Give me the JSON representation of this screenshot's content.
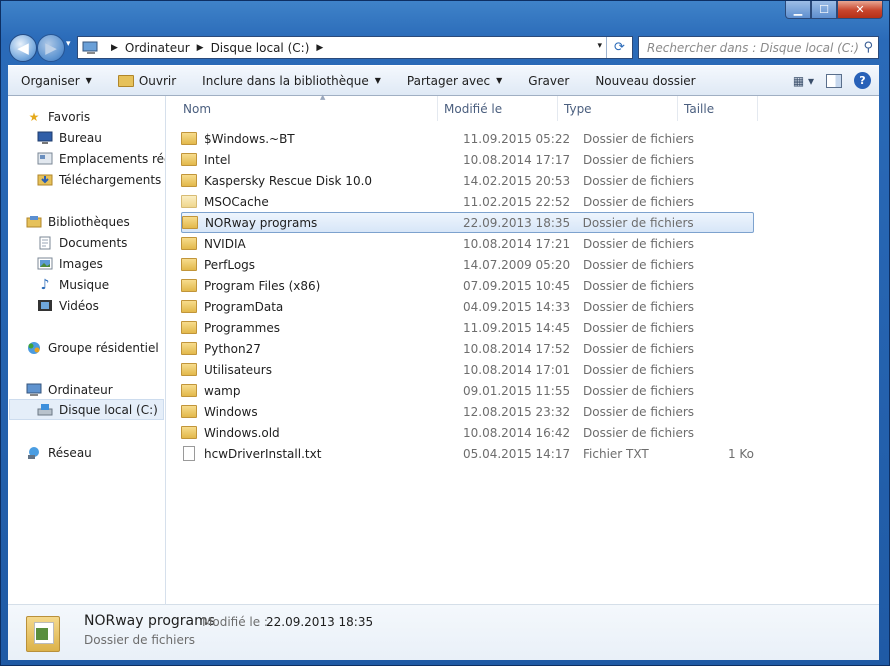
{
  "window": {
    "minimize": "▁",
    "maximize": "☐",
    "close": "✕"
  },
  "nav_buttons": {
    "back": "◀",
    "forward": "▶",
    "recent": "▾"
  },
  "address": {
    "crumbs": [
      "Ordinateur",
      "Disque local (C:)"
    ],
    "separator": "▶",
    "dropdown": "▾",
    "refresh": "⟳"
  },
  "search": {
    "placeholder": "Rechercher dans : Disque local (C:)",
    "icon": "⚲"
  },
  "toolbar": {
    "organize": "Organiser",
    "open": "Ouvrir",
    "include": "Inclure dans la bibliothèque",
    "share": "Partager avec",
    "burn": "Graver",
    "new_folder": "Nouveau dossier",
    "arrow": "▼",
    "views": "▦ ▾",
    "help": "?"
  },
  "sidebar": {
    "favorites": "Favoris",
    "desktop": "Bureau",
    "recent_places": "Emplacements récents",
    "downloads": "Téléchargements",
    "libraries": "Bibliothèques",
    "documents": "Documents",
    "images": "Images",
    "music": "Musique",
    "videos": "Vidéos",
    "homegroup": "Groupe résidentiel",
    "computer": "Ordinateur",
    "local_disk": "Disque local (C:)",
    "network": "Réseau"
  },
  "columns": {
    "name": "Nom",
    "modified": "Modifié le",
    "type": "Type",
    "size": "Taille",
    "sort_indicator": "▲"
  },
  "files": [
    {
      "name": "$Windows.~BT",
      "date": "11.09.2015 05:22",
      "type": "Dossier de fichiers",
      "size": ""
    },
    {
      "name": "Intel",
      "date": "10.08.2014 17:17",
      "type": "Dossier de fichiers",
      "size": ""
    },
    {
      "name": "Kaspersky Rescue Disk 10.0",
      "date": "14.02.2015 20:53",
      "type": "Dossier de fichiers",
      "size": ""
    },
    {
      "name": "MSOCache",
      "date": "11.02.2015 22:52",
      "type": "Dossier de fichiers",
      "size": ""
    },
    {
      "name": "NORway programs",
      "date": "22.09.2013 18:35",
      "type": "Dossier de fichiers",
      "size": ""
    },
    {
      "name": "NVIDIA",
      "date": "10.08.2014 17:21",
      "type": "Dossier de fichiers",
      "size": ""
    },
    {
      "name": "PerfLogs",
      "date": "14.07.2009 05:20",
      "type": "Dossier de fichiers",
      "size": ""
    },
    {
      "name": "Program Files (x86)",
      "date": "07.09.2015 10:45",
      "type": "Dossier de fichiers",
      "size": ""
    },
    {
      "name": "ProgramData",
      "date": "04.09.2015 14:33",
      "type": "Dossier de fichiers",
      "size": ""
    },
    {
      "name": "Programmes",
      "date": "11.09.2015 14:45",
      "type": "Dossier de fichiers",
      "size": ""
    },
    {
      "name": "Python27",
      "date": "10.08.2014 17:52",
      "type": "Dossier de fichiers",
      "size": ""
    },
    {
      "name": "Utilisateurs",
      "date": "10.08.2014 17:01",
      "type": "Dossier de fichiers",
      "size": ""
    },
    {
      "name": "wamp",
      "date": "09.01.2015 11:55",
      "type": "Dossier de fichiers",
      "size": ""
    },
    {
      "name": "Windows",
      "date": "12.08.2015 23:32",
      "type": "Dossier de fichiers",
      "size": ""
    },
    {
      "name": "Windows.old",
      "date": "10.08.2014 16:42",
      "type": "Dossier de fichiers",
      "size": ""
    },
    {
      "name": "hcwDriverInstall.txt",
      "date": "05.04.2015 14:17",
      "type": "Fichier TXT",
      "size": "1 Ko"
    }
  ],
  "details": {
    "name": "NORway programs",
    "modified_label": "Modifié le :",
    "modified_value": "22.09.2013 18:35",
    "type": "Dossier de fichiers"
  }
}
